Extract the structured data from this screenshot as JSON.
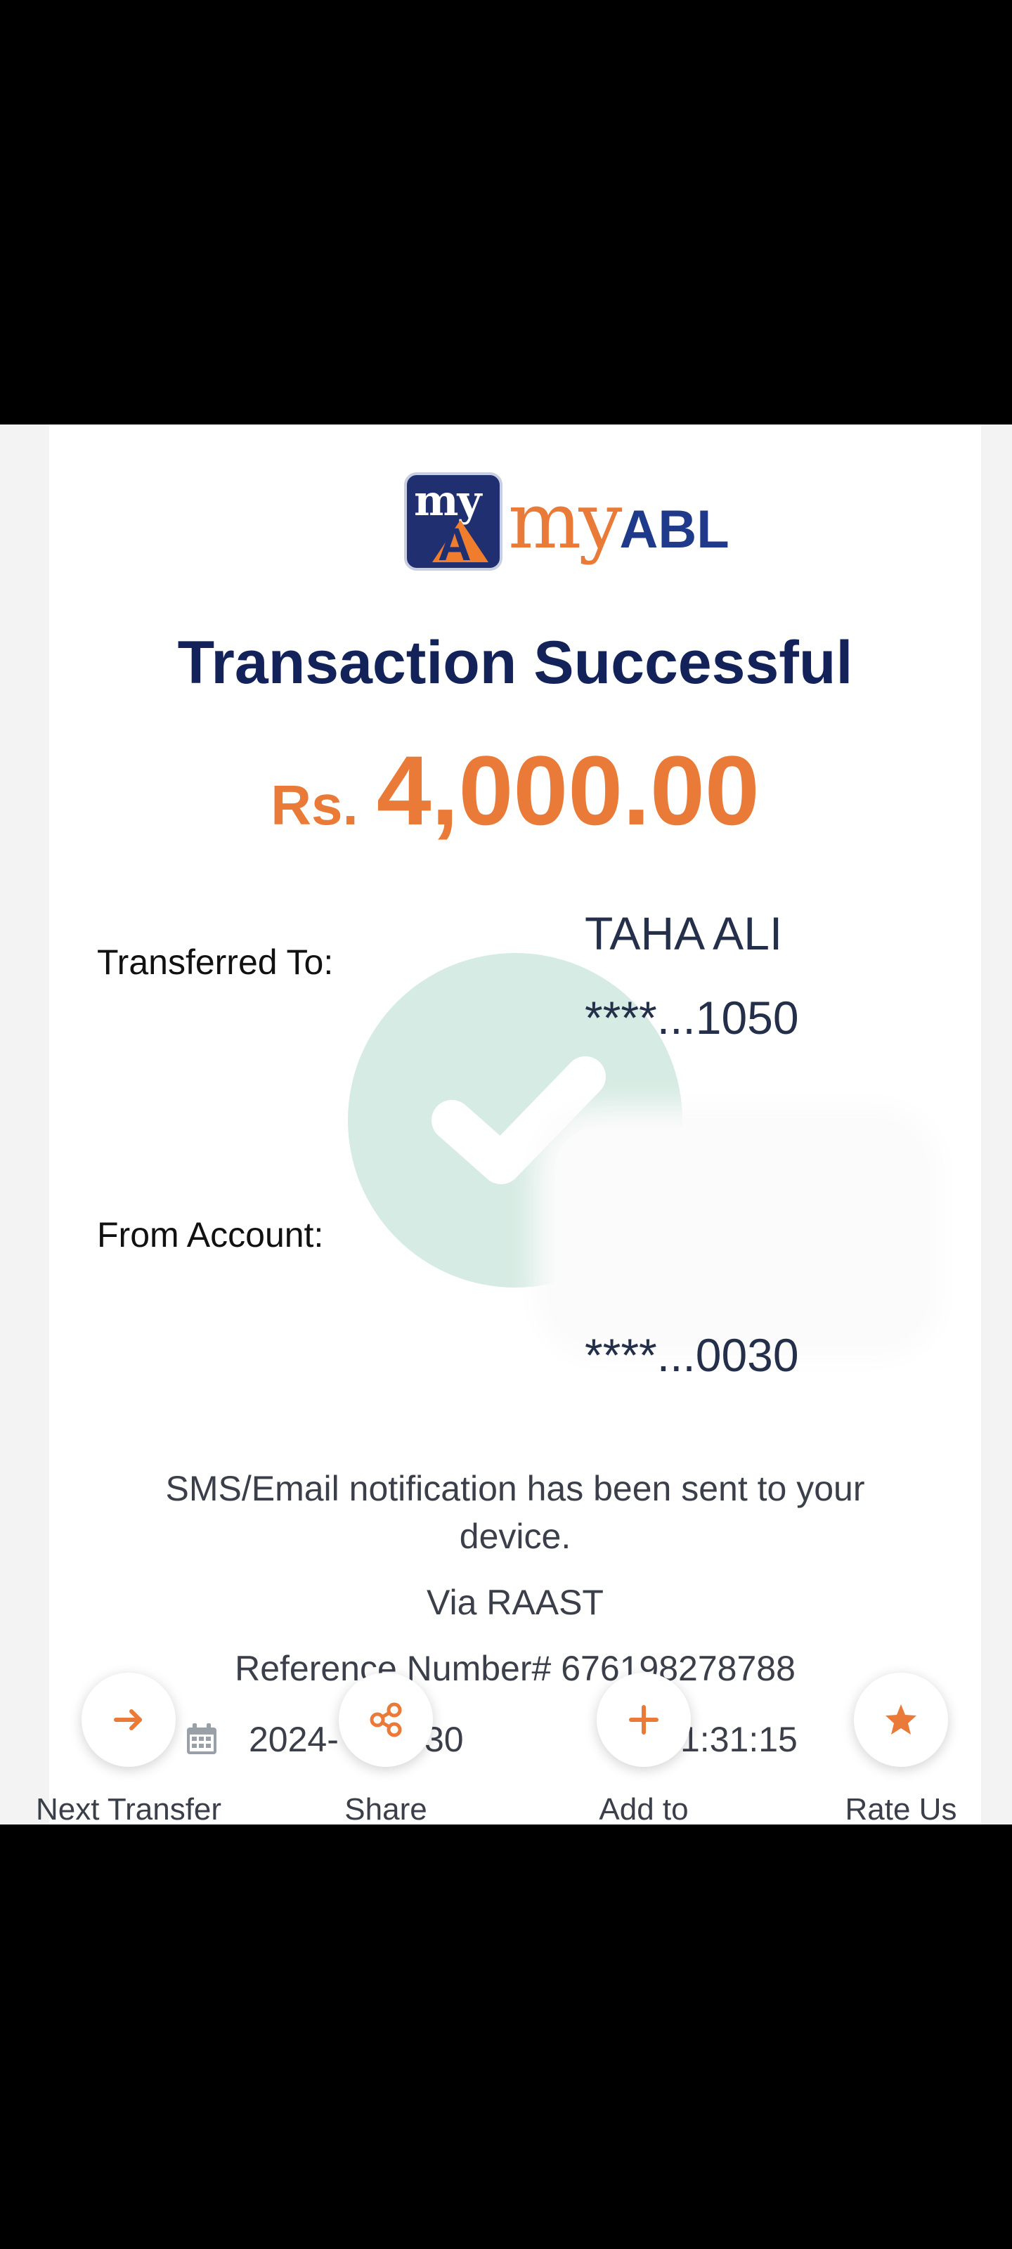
{
  "brand": {
    "logo_text_my": "my",
    "logo_text_abl": "ABL",
    "logo_badge_my": "my",
    "logo_badge_a": "A",
    "accent": "#e97a37",
    "navy": "#13235a"
  },
  "receipt": {
    "title": "Transaction Successful",
    "currency": "Rs.",
    "amount": "4,000.00",
    "transferred_to_label": "Transferred To:",
    "recipient_name": "TAHA ALI",
    "recipient_account": "****...1050",
    "from_account_label": "From Account:",
    "from_account_number": "****...0030",
    "notification_text": "SMS/Email notification has been sent to your device.",
    "via": "Via RAAST",
    "reference": "Reference Number# 676198278788",
    "date_partial": "2024-",
    "date_tail": "30",
    "time_partial": "1:31:15"
  },
  "actions": [
    {
      "label": "Next Transfer",
      "icon": "arrow-right-icon"
    },
    {
      "label": "Share",
      "icon": "share-icon"
    },
    {
      "label": "Add to",
      "icon": "plus-icon"
    },
    {
      "label": "Rate Us",
      "icon": "star-icon"
    }
  ],
  "icons": {
    "success": "check-icon",
    "calendar": "calendar-icon"
  }
}
